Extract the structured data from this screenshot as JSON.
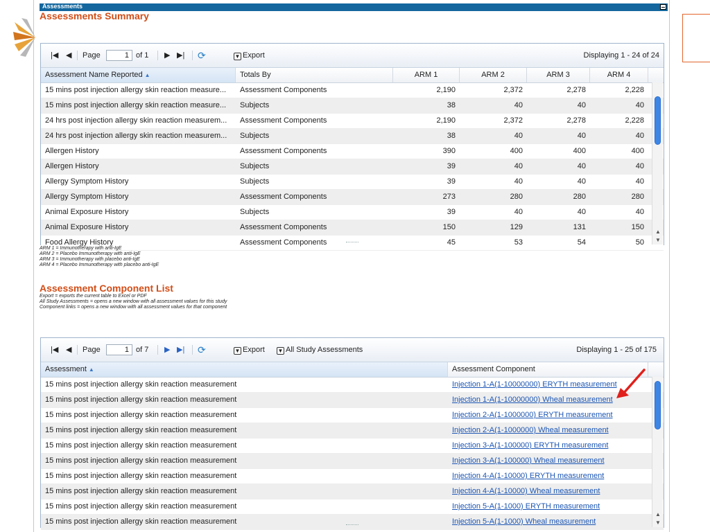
{
  "panel": {
    "title": "Assessments"
  },
  "summary": {
    "title": "Assessments Summary",
    "toolbar": {
      "page_label": "Page",
      "page_value": "1",
      "of_label": "of 1",
      "export_label": "Export",
      "displaying": "Displaying 1 - 24 of 24"
    },
    "columns": [
      "Assessment Name Reported",
      "Totals By",
      "ARM 1",
      "ARM 2",
      "ARM 3",
      "ARM 4"
    ],
    "rows": [
      [
        "15 mins post injection allergy skin reaction measure...",
        "Assessment Components",
        "2,190",
        "2,372",
        "2,278",
        "2,228"
      ],
      [
        "15 mins post injection allergy skin reaction measure...",
        "Subjects",
        "38",
        "40",
        "40",
        "40"
      ],
      [
        "24 hrs post injection allergy skin reaction measurem...",
        "Assessment Components",
        "2,190",
        "2,372",
        "2,278",
        "2,228"
      ],
      [
        "24 hrs post injection allergy skin reaction measurem...",
        "Subjects",
        "38",
        "40",
        "40",
        "40"
      ],
      [
        "Allergen History",
        "Assessment Components",
        "390",
        "400",
        "400",
        "400"
      ],
      [
        "Allergen History",
        "Subjects",
        "39",
        "40",
        "40",
        "40"
      ],
      [
        "Allergy Symptom History",
        "Subjects",
        "39",
        "40",
        "40",
        "40"
      ],
      [
        "Allergy Symptom History",
        "Assessment Components",
        "273",
        "280",
        "280",
        "280"
      ],
      [
        "Animal Exposure History",
        "Subjects",
        "39",
        "40",
        "40",
        "40"
      ],
      [
        "Animal Exposure History",
        "Assessment Components",
        "150",
        "129",
        "131",
        "150"
      ],
      [
        "Food Allergy History",
        "Assessment Components",
        "45",
        "53",
        "54",
        "50"
      ]
    ],
    "notes": [
      "ARM 1 = Immunotherapy with anti-IgE",
      "ARM 2 = Placebo Immunotherapy with anti-IgE",
      "ARM 3 = Immunotherapy with placebo anti-IgE",
      "ARM 4 = Placebo Immunotherapy with placebo anti-IgE"
    ]
  },
  "components": {
    "title": "Assessment Component List",
    "notes": [
      "Export = exports the current table to Excel or PDF",
      "All Study Assessments = opens a new window with all assessment values for this study",
      "Component links = opens a new window with all assessment values for that component"
    ],
    "toolbar": {
      "page_label": "Page",
      "page_value": "1",
      "of_label": "of 7",
      "export_label": "Export",
      "all_label": "All Study Assessments",
      "displaying": "Displaying 1 - 25 of 175"
    },
    "columns": [
      "Assessment",
      "Assessment Component"
    ],
    "rows": [
      [
        "15 mins post injection allergy skin reaction measurement",
        "Injection 1-A(1-10000000) ERYTH measurement"
      ],
      [
        "15 mins post injection allergy skin reaction measurement",
        "Injection 1-A(1-10000000) Wheal measurement"
      ],
      [
        "15 mins post injection allergy skin reaction measurement",
        "Injection 2-A(1-1000000) ERYTH measurement"
      ],
      [
        "15 mins post injection allergy skin reaction measurement",
        "Injection 2-A(1-1000000) Wheal measurement"
      ],
      [
        "15 mins post injection allergy skin reaction measurement",
        "Injection 3-A(1-100000) ERYTH measurement"
      ],
      [
        "15 mins post injection allergy skin reaction measurement",
        "Injection 3-A(1-100000) Wheal measurement"
      ],
      [
        "15 mins post injection allergy skin reaction measurement",
        "Injection 4-A(1-10000) ERYTH measurement"
      ],
      [
        "15 mins post injection allergy skin reaction measurement",
        "Injection 4-A(1-10000) Wheal measurement"
      ],
      [
        "15 mins post injection allergy skin reaction measurement",
        "Injection 5-A(1-1000) ERYTH measurement"
      ],
      [
        "15 mins post injection allergy skin reaction measurement",
        "Injection 5-A(1-1000) Wheal measurement"
      ]
    ]
  },
  "icons": {
    "first": "first-page-icon",
    "prev": "prev-page-icon",
    "next": "next-page-icon",
    "last": "last-page-icon",
    "refresh": "refresh-icon",
    "export": "export-icon",
    "sort": "sort-asc-icon",
    "annotation": "red-arrow-icon",
    "logo": "logo-icon"
  },
  "colors": {
    "accent": "#13679e",
    "title": "#d14e18",
    "link": "#1b55b3",
    "annotation": "#e0201c"
  }
}
